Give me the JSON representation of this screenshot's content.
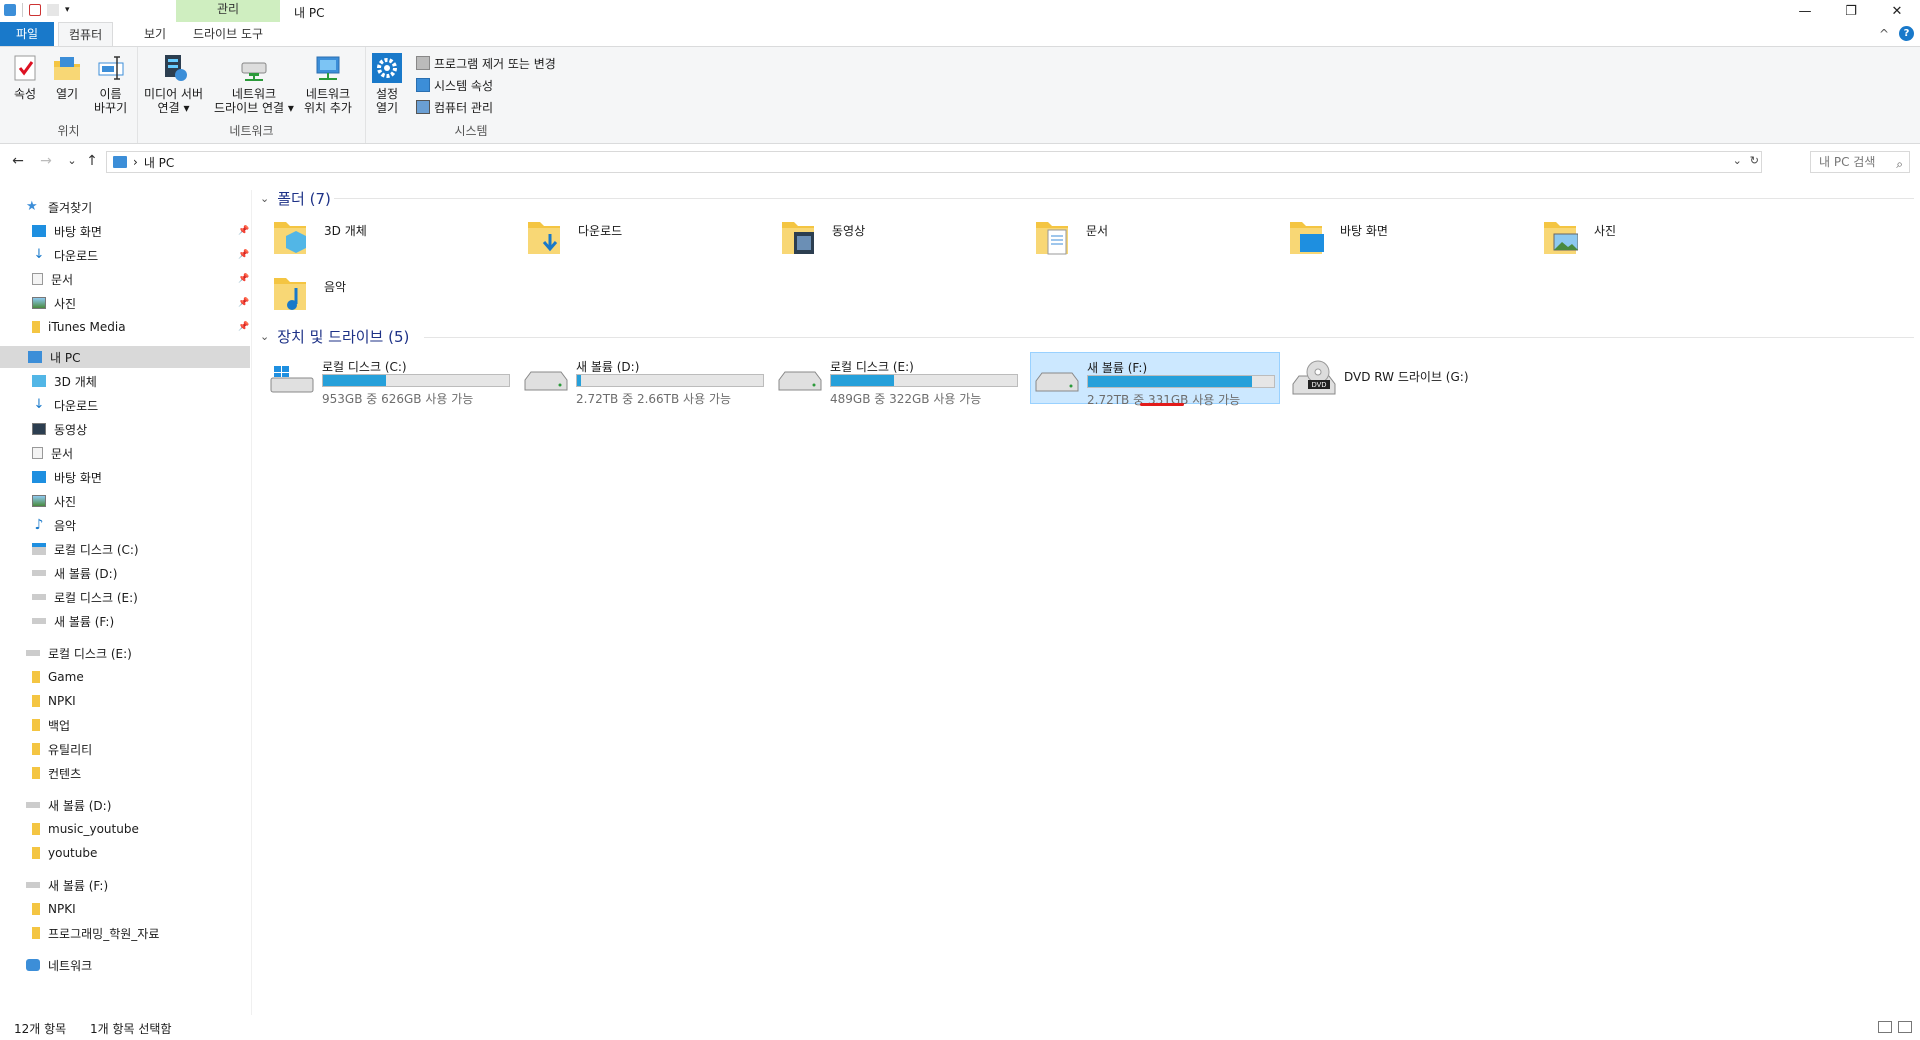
{
  "window": {
    "title": "내 PC",
    "context_tab_group": "관리",
    "minimize": "—",
    "restore": "❐",
    "close": "✕"
  },
  "tabs": {
    "file": "파일",
    "computer": "컴퓨터",
    "view": "보기",
    "drive_tools": "드라이브 도구",
    "collapse": "^",
    "help": "?"
  },
  "ribbon": {
    "location": {
      "label": "위치",
      "properties": "속성",
      "open": "열기",
      "rename_line1": "이름",
      "rename_line2": "바꾸기"
    },
    "network": {
      "label": "네트워크",
      "media_line1": "미디어 서버",
      "media_line2": "연결 ▾",
      "map_line1": "네트워크",
      "map_line2": "드라이브 연결 ▾",
      "add_line1": "네트워크",
      "add_line2": "위치 추가"
    },
    "system": {
      "label": "시스템",
      "settings_line1": "설정",
      "settings_line2": "열기",
      "uninstall": "프로그램 제거 또는 변경",
      "sys_props": "시스템 속성",
      "manage": "컴퓨터 관리"
    }
  },
  "address": {
    "back": "←",
    "forward": "→",
    "recent": "⌄",
    "up": "↑",
    "path_sep": "›",
    "path": "내 PC",
    "dropdown": "⌄",
    "refresh": "↻",
    "search_placeholder": "내 PC 검색",
    "search_icon": "⌕"
  },
  "nav": {
    "quick_access": "즐겨찾기",
    "qa_desktop": "바탕 화면",
    "qa_downloads": "다운로드",
    "qa_documents": "문서",
    "qa_pictures": "사진",
    "qa_itunes": "iTunes Media",
    "this_pc": "내 PC",
    "pc_3d": "3D 개체",
    "pc_downloads": "다운로드",
    "pc_videos": "동영상",
    "pc_documents": "문서",
    "pc_desktop": "바탕 화면",
    "pc_pictures": "사진",
    "pc_music": "음악",
    "pc_c": "로컬 디스크 (C:)",
    "pc_d": "새 볼륨 (D:)",
    "pc_e": "로컬 디스크 (E:)",
    "pc_f": "새 볼륨 (F:)",
    "e_root": "로컬 디스크 (E:)",
    "e_game": "Game",
    "e_npki": "NPKI",
    "e_backup": "백업",
    "e_utility": "유틸리티",
    "e_contents": "컨텐츠",
    "d_root": "새 볼륨 (D:)",
    "d_music_youtube": "music_youtube",
    "d_youtube": "youtube",
    "f_root": "새 볼륨 (F:)",
    "f_npki": "NPKI",
    "f_prog": "프로그래밍_학원_자료",
    "network": "네트워크"
  },
  "content": {
    "folders_header": "폴더 (7)",
    "devices_header": "장치 및 드라이브 (5)",
    "folders": {
      "f3d": "3D 개체",
      "downloads": "다운로드",
      "videos": "동영상",
      "documents": "문서",
      "desktop": "바탕 화면",
      "pictures": "사진",
      "music": "음악"
    },
    "drives": {
      "c": {
        "name": "로컬 디스크 (C:)",
        "size": "953GB 중 626GB 사용 가능",
        "used_fraction": 0.34
      },
      "d": {
        "name": "새 볼륨 (D:)",
        "size": "2.72TB 중 2.66TB 사용 가능",
        "used_fraction": 0.02
      },
      "e": {
        "name": "로컬 디스크 (E:)",
        "size": "489GB 중 322GB 사용 가능",
        "used_fraction": 0.34
      },
      "f": {
        "name": "새 볼륨 (F:)",
        "size": "2.72TB 중 331GB 사용 가능",
        "used_fraction": 0.88
      },
      "g": {
        "name": "DVD RW 드라이브 (G:)",
        "badge": "DVD"
      }
    }
  },
  "status": {
    "count": "12개 항목",
    "selected": "1개 항목 선택함"
  },
  "colors": {
    "accent": "#1979ca",
    "bar_fill": "#26a0da",
    "selection": "#cce8ff",
    "header_blue": "#1e3287",
    "highlight_red": "#e21b1b"
  }
}
